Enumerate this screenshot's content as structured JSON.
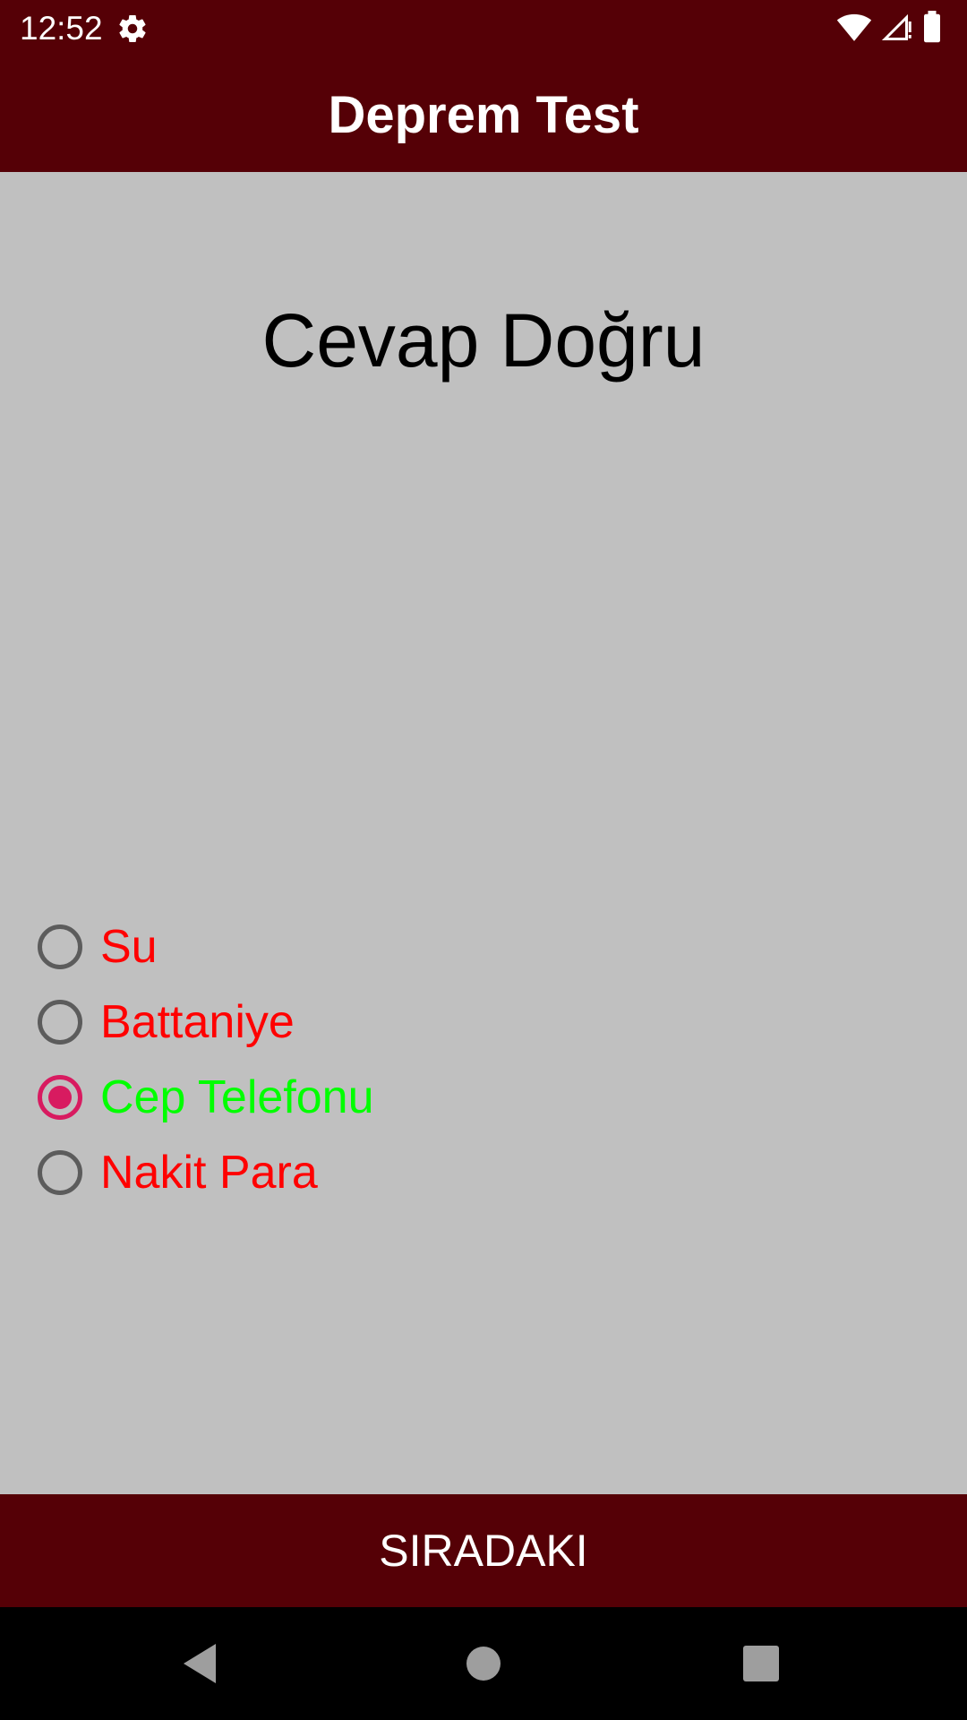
{
  "status_bar": {
    "time": "12:52",
    "icons": [
      "settings-icon",
      "wifi-icon",
      "signal-icon",
      "battery-icon"
    ]
  },
  "app_bar": {
    "title": "Deprem Test"
  },
  "result": {
    "text": "Cevap Doğru"
  },
  "options": [
    {
      "label": "Su",
      "checked": false,
      "color": "#ff0000"
    },
    {
      "label": "Battaniye",
      "checked": false,
      "color": "#ff0000"
    },
    {
      "label": "Cep Telefonu",
      "checked": true,
      "color": "#00ff00"
    },
    {
      "label": "Nakit Para",
      "checked": false,
      "color": "#ff0000"
    }
  ],
  "next_button": {
    "label": "SIRADAKI"
  },
  "nav_bar": {
    "icons": [
      "back-icon",
      "home-icon",
      "recents-icon"
    ]
  },
  "colors": {
    "primary_dark": "#550006",
    "background": "#c0c0c0",
    "radio_accent": "#d81b60",
    "wrong_option": "#ff0000",
    "correct_option": "#00ff00"
  }
}
